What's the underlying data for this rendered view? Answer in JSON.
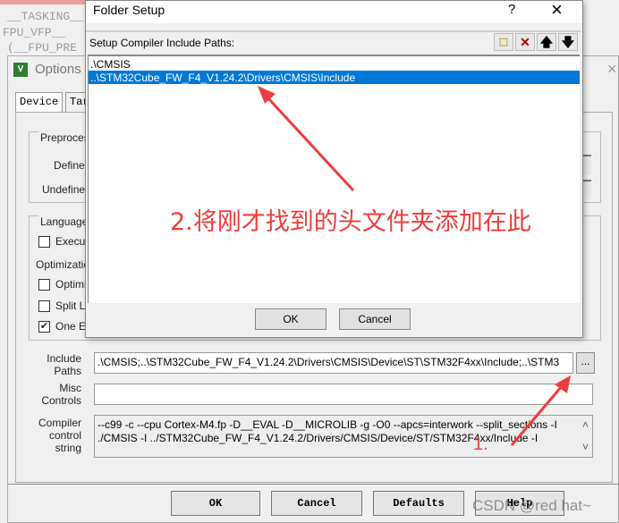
{
  "background_code": [
    "__TASKING__",
    "FPU_VFP__",
    "(__FPU_PRE"
  ],
  "options_window": {
    "title": "Options",
    "tabs": [
      "Device",
      "Tar"
    ],
    "preprocessor": {
      "group": "Preproces",
      "define": "Define",
      "undefine": "Undefine"
    },
    "language": {
      "group": "Language",
      "execute": "Execu",
      "optimization": "Optimizatio",
      "optimize": "Optimi",
      "split": "Split L",
      "one": "One E"
    },
    "include_paths_label": "Include Paths",
    "include_paths_value": ".\\CMSIS;..\\STM32Cube_FW_F4_V1.24.2\\Drivers\\CMSIS\\Device\\ST\\STM32F4xx\\Include;..\\STM3",
    "browse_label": "...",
    "misc_controls_label": "Misc Controls",
    "misc_controls_value": "",
    "compiler_control_label": "Compiler control string",
    "compiler_control_lines": [
      "--c99 -c --cpu Cortex-M4.fp -D__EVAL -D__MICROLIB -g -O0 --apcs=interwork --split_sections -I",
      "./CMSIS -I ../STM32Cube_FW_F4_V1.24.2/Drivers/CMSIS/Device/ST/STM32F4xx/Include -I"
    ],
    "buttons": {
      "ok": "OK",
      "cancel": "Cancel",
      "defaults": "Defaults",
      "help": "Help"
    }
  },
  "folder_setup": {
    "title": "Folder Setup",
    "help": "?",
    "close": "×",
    "label": "Setup Compiler Include Paths:",
    "toolbar": [
      "new-folder-icon",
      "delete-icon",
      "move-up-icon",
      "move-down-icon"
    ],
    "paths": [
      {
        "text": ".\\CMSIS",
        "selected": false
      },
      {
        "text": "..\\STM32Cube_FW_F4_V1.24.2\\Drivers\\CMSIS\\Include",
        "selected": true
      }
    ],
    "ok": "OK",
    "cancel": "Cancel",
    "selection_color": "#0078d7"
  },
  "annotations": {
    "step1": "1.",
    "step2": "2.将刚才找到的头文件夹添加在此",
    "color": "#f03c3c"
  },
  "watermark": "CSDN @red hat~"
}
